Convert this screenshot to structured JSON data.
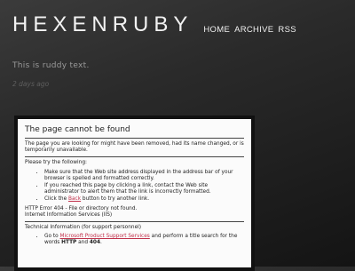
{
  "header": {
    "title": "HEXENRUBY",
    "nav": [
      {
        "label": "HOME"
      },
      {
        "label": "ARCHIVE"
      },
      {
        "label": "RSS"
      }
    ]
  },
  "post": {
    "text": "This is ruddy text.",
    "date": "2 days ago"
  },
  "embedded_error_page": {
    "title": "The page cannot be found",
    "intro": "The page you are looking for might have been removed, had its name changed, or is temporarily unavailable.",
    "try_heading": "Please try the following:",
    "items": [
      "Make sure that the Web site address displayed in the address bar of your browser is spelled and formatted correctly.",
      "If you reached this page by clicking a link, contact the Web site administrator to alert them that the link is incorrectly formatted.",
      {
        "before": "Click the ",
        "link": "Back",
        "after": " button to try another link."
      }
    ],
    "error_code": "HTTP Error 404 - File or directory not found.",
    "server": "Internet Information Services (IIS)",
    "tech_heading": "Technical Information (for support personnel)",
    "tech_items": [
      {
        "before": "Go to ",
        "link": "Microsoft Product Support Services",
        "after": " and perform a title search for the words ",
        "bold1": "HTTP",
        "mid": " and ",
        "bold2": "404",
        "end": "."
      }
    ]
  }
}
